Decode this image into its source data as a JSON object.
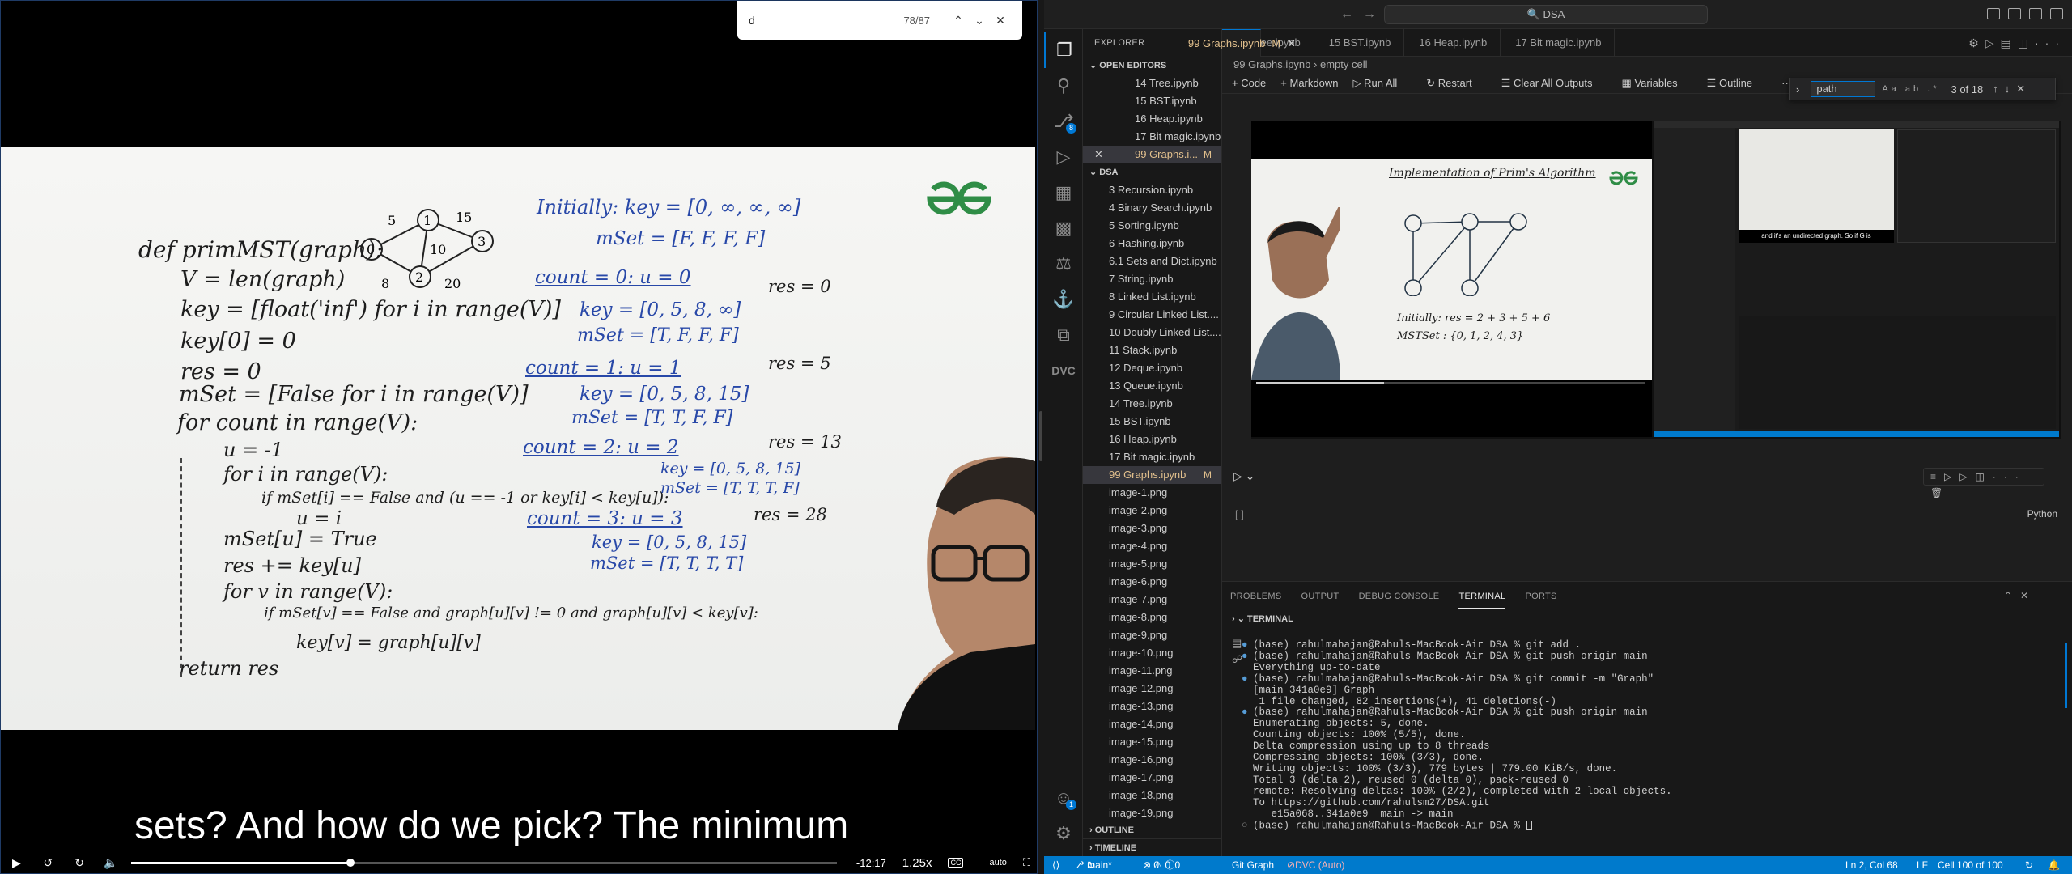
{
  "video": {
    "find_query": "d",
    "find_count": "78/87",
    "caption": "sets? And how do we pick? The minimum",
    "time_remaining": "-12:17",
    "speed": "1.25x",
    "quality": "auto",
    "progress": 0.31,
    "board": {
      "code": [
        "def primMST(graph):",
        "V = len(graph)",
        "key = [float('inf') for i in range(V)]",
        "key[0] = 0",
        "res = 0",
        "mSet = [False for i in range(V)]",
        "for count in range(V):",
        "u = -1",
        "for i in range(V):",
        "if mSet[i] == False and (u == -1 or key[i] < key[u]):",
        "u = i",
        "mSet[u] = True",
        "res += key[u]",
        "for v in range(V):",
        "if mSet[v] == False and graph[u][v] != 0 and graph[u][v] < key[v]:",
        "key[v] = graph[u][v]",
        "return res"
      ],
      "trace": [
        "Initially: key = [0, ∞, ∞, ∞]",
        "mSet = [F, F, F, F]",
        "count = 0:  u = 0",
        "key = [0, 5, 8, ∞]",
        "mSet = [T, F, F, F]",
        "count = 1:  u = 1",
        "key = [0, 5, 8, 15]",
        "mSet = [T, T, F, F]",
        "count = 2:  u = 2",
        "key = [0, 5, 8, 15]",
        "mSet = [T, T, T, F]",
        "count = 3:  u = 3",
        "key = [0, 5, 8, 15]",
        "mSet = [T, T, T, T]"
      ],
      "res": [
        "res = 0",
        "res = 5",
        "res = 13",
        "res = 28"
      ],
      "graph_nodes": [
        "0",
        "1",
        "2",
        "3"
      ],
      "graph_weights": [
        "5",
        "15",
        "10",
        "8",
        "20"
      ]
    }
  },
  "vscode": {
    "title": "DSA",
    "activity_badges": {
      "scm": "8",
      "account": "1"
    },
    "explorer_label": "EXPLORER",
    "open_editors_label": "OPEN EDITORS",
    "open_editors": [
      {
        "name": "14 Tree.ipynb"
      },
      {
        "name": "15 BST.ipynb"
      },
      {
        "name": "16 Heap.ipynb"
      },
      {
        "name": "17 Bit magic.ipynb"
      },
      {
        "name": "99 Graphs.i...",
        "modified": "M"
      }
    ],
    "folder_label": "DSA",
    "files": [
      "3 Recursion.ipynb",
      "4 Binary Search.ipynb",
      "5 Sorting.ipynb",
      "6 Hashing.ipynb",
      "6.1 Sets and Dict.ipynb",
      "7 String.ipynb",
      "8 Linked List.ipynb",
      "9 Circular Linked List....",
      "10 Doubly Linked List....",
      "11 Stack.ipynb",
      "12 Deque.ipynb",
      "13 Queue.ipynb",
      "14 Tree.ipynb",
      "15 BST.ipynb",
      "16 Heap.ipynb",
      "17 Bit magic.ipynb",
      "99 Graphs.ipynb",
      "image-1.png",
      "image-2.png",
      "image-3.png",
      "image-4.png",
      "image-5.png",
      "image-6.png",
      "image-7.png",
      "image-8.png",
      "image-9.png",
      "image-10.png",
      "image-11.png",
      "image-12.png",
      "image-13.png",
      "image-14.png",
      "image-15.png",
      "image-16.png",
      "image-17.png",
      "image-18.png",
      "image-19.png"
    ],
    "modified_file_marker": "M",
    "outline_label": "OUTLINE",
    "timeline_label": "TIMELINE",
    "tabs": [
      {
        "label": "14 Tree.ipynb"
      },
      {
        "label": "15 BST.ipynb"
      },
      {
        "label": "16 Heap.ipynb"
      },
      {
        "label": "17 Bit magic.ipynb"
      },
      {
        "label": "99 Graphs.ipynb",
        "mark": "M"
      }
    ],
    "breadcrumb": [
      "99 Graphs.ipynb",
      "empty cell"
    ],
    "toolbar": [
      "+ Code",
      "+ Markdown",
      "Run All",
      "Restart",
      "Clear All Outputs",
      "Variables",
      "Outline",
      "···"
    ],
    "find": {
      "query": "path",
      "options": "Aa ab .*",
      "count": "3 of 18"
    },
    "cell_bracket": "[ ]",
    "cell_lang": "Python",
    "inner_board": {
      "title": "Implementation of Prim's Algorithm",
      "line1": "Initially: res = 2 + 3 + 5 + 6",
      "line2": "MSTSet : {0, 1, 2, 4, 3}"
    },
    "inner_caption": "and it's an undirected graph. So if G is",
    "panel_tabs": [
      "PROBLEMS",
      "OUTPUT",
      "DEBUG CONSOLE",
      "TERMINAL",
      "PORTS"
    ],
    "terminal_label": "TERMINAL",
    "terminal": [
      "(base) rahulmahajan@Rahuls-MacBook-Air DSA % git add .",
      "(base) rahulmahajan@Rahuls-MacBook-Air DSA % git push origin main",
      "Everything up-to-date",
      "(base) rahulmahajan@Rahuls-MacBook-Air DSA % git commit -m \"Graph\"",
      "[main 341a0e9] Graph",
      " 1 file changed, 82 insertions(+), 41 deletions(-)",
      "(base) rahulmahajan@Rahuls-MacBook-Air DSA % git push origin main",
      "Enumerating objects: 5, done.",
      "Counting objects: 100% (5/5), done.",
      "Delta compression using up to 8 threads",
      "Compressing objects: 100% (3/3), done.",
      "Writing objects: 100% (3/3), 779 bytes | 779.00 KiB/s, done.",
      "Total 3 (delta 2), reused 0 (delta 0), pack-reused 0",
      "remote: Resolving deltas: 100% (2/2), completed with 2 local objects.",
      "To https://github.com/rahulsm27/DSA.git",
      "   e15a068..341a0e9  main -> main",
      "(base) rahulmahajan@Rahuls-MacBook-Air DSA % "
    ],
    "status": {
      "branch": "main*",
      "errors": "0",
      "warnings": "0",
      "info": "0",
      "git_graph": "Git Graph",
      "dvc": "DVC (Auto)",
      "position": "Ln 2, Col 68",
      "eol": "LF",
      "cell": "Cell 100 of 100"
    }
  }
}
